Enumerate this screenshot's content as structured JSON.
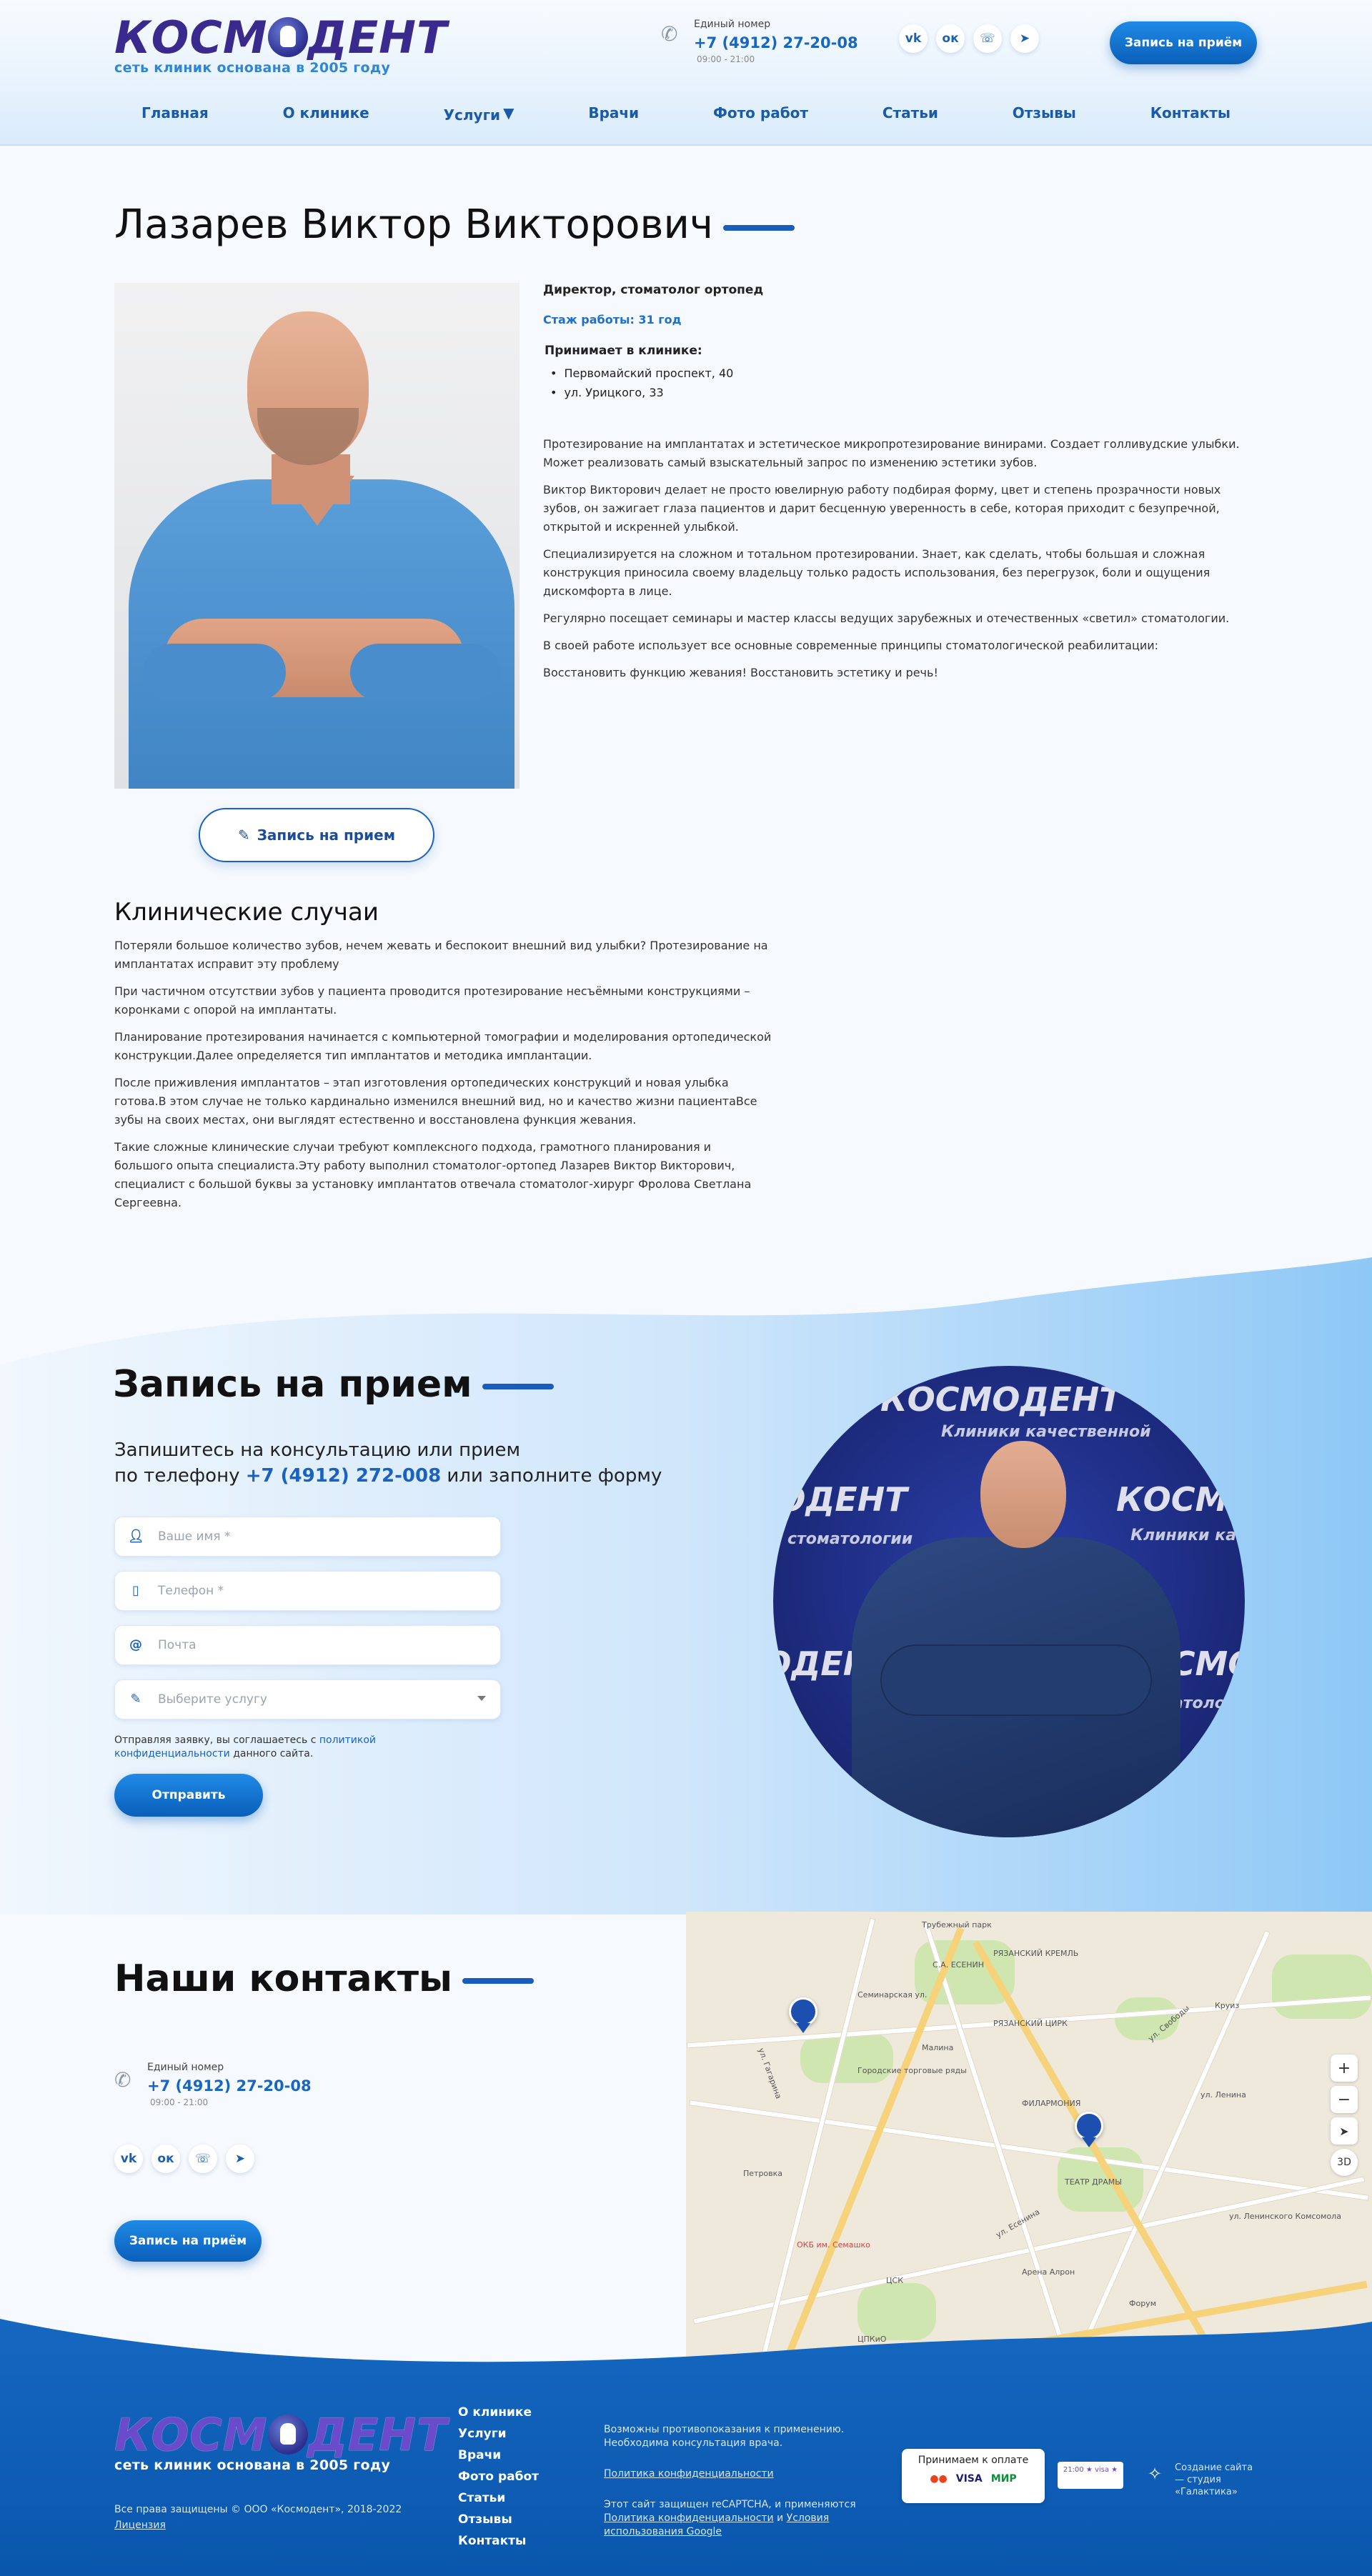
{
  "header": {
    "logo_text": "КОСМОДЕНТ",
    "logo_tagline": "сеть клиник основана в 2005 году",
    "phone_label": "Единый номер",
    "phone_number": "+7 (4912) 27-20-08",
    "phone_hours": "09:00 - 21:00",
    "socials": [
      "vk-icon",
      "ok-icon",
      "whatsapp-icon",
      "telegram-icon"
    ],
    "cta": "Запись на приём",
    "nav": [
      "Главная",
      "О клинике",
      "Услуги",
      "Врачи",
      "Фото работ",
      "Статьи",
      "Отзывы",
      "Контакты"
    ]
  },
  "doctor": {
    "name": "Лазарев Виктор Викторович",
    "role": "Директор, стоматолог ортопед",
    "experience": "Стаж работы: 31 год",
    "receives_label": "Принимает в клинике:",
    "addresses": [
      "Первомайский проспект, 40",
      "ул. Урицкого, 33"
    ],
    "paragraphs": [
      "Протезирование на имплантатах и эстетическое микропротезирование винирами. Создает голливудские улыбки. Может реализовать самый взыскательный запрос по изменению эстетики зубов.",
      "Виктор Викторович делает не просто ювелирную работу подбирая форму, цвет и степень прозрачности новых зубов, он зажигает глаза пациентов и дарит бесценную уверенность в себе, которая приходит с безупречной, открытой и искренней улыбкой.",
      "Специализируется на сложном и тотальном протезировании. Знает, как сделать, чтобы большая и сложная конструкция приносила своему владельцу только радость использования, без перегрузок, боли и ощущения дискомфорта в лице.",
      "Регулярно посещает семинары и мастер классы ведущих зарубежных и отечественных «светил» стоматологии.",
      "В своей работе использует все основные современные принципы стоматологической реабилитации:",
      "Восстановить функцию жевания! Восстановить эстетику и речь!"
    ],
    "book_button": "Запись на прием"
  },
  "cases": {
    "title": "Клинические случаи",
    "paragraphs": [
      "Потеряли большое количество зубов, нечем жевать и беспокоит внешний вид улыбки? Протезирование на имплантатах исправит эту проблему",
      "При частичном отсутствии зубов у пациента проводится протезирование несъёмными конструкциями – коронками с опорой на имплантаты.",
      "Планирование протезирования начинается с компьютерной томографии и моделирования ортопедической конструкции.Далее определяется тип имплантатов и методика имплантации.",
      "После приживления имплантатов – этап изготовления ортопедических конструкций и новая улыбка готова.В этом случае не только кардинально изменился внешний вид, но и качество жизни пациентаВсе зубы на своих местах, они выглядят естественно и восстановлена функция жевания.",
      "Такие сложные клинические случаи требуют комплексного подхода, грамотного планирования и большого опыта специалиста.Эту работу выполнил стоматолог-ортопед Лазарев Виктор Викторович, специалист с большой буквы за установку имплантатов отвечала стоматолог-хирург Фролова Светлана Сергеевна."
    ]
  },
  "appointment": {
    "title": "Запись на прием",
    "subtitle_before": "Запишитесь на консультацию или прием",
    "subtitle_line2_before": "по телефону ",
    "subtitle_phone": "+7 (4912) 272-008",
    "subtitle_after": " или заполните форму",
    "fields": {
      "name_placeholder": "Ваше имя *",
      "phone_placeholder": "Телефон *",
      "email_placeholder": "Почта",
      "service_placeholder": "Выберите услугу"
    },
    "consent_before": "Отправляя заявку, вы соглашаетесь с ",
    "consent_link": "политикой конфиденциальности",
    "consent_after": " данного сайта.",
    "submit": "Отправить",
    "photo_banner_text": [
      "КОСМОДЕНТ",
      "Клиники качественной",
      "стоматологии"
    ]
  },
  "contacts": {
    "title": "Наши контакты",
    "phone_label": "Единый номер",
    "phone_number": "+7 (4912) 27-20-08",
    "phone_hours": "09:00 - 21:00",
    "cta": "Запись на приём",
    "map": {
      "labels": [
        "Трубежный парк",
        "Семинарская ул.",
        "С.А. ЕСЕНИН",
        "РЯЗАНСКИЙ КРЕМЛЬ",
        "РЯЗАНСКИЙ ЦИРК",
        "Малина",
        "ФИЛАРМОНИЯ",
        "Городские торговые ряды",
        "ул. Свободы",
        "ул. Ленина",
        "ТЕАТР ДРАМЫ",
        "Петровка",
        "Круиз",
        "ул. Есенина",
        "ОКБ им. Семашко",
        "ЦСК",
        "Арена Алрон",
        "Форум",
        "ЦПКиО",
        "ул. Гагарина",
        "ул. Ленинского Комсомола"
      ],
      "controls": [
        "+",
        "−",
        "➤",
        "3D"
      ]
    }
  },
  "footer": {
    "logo_text": "КОСМОДЕНТ",
    "logo_tagline": "сеть клиник основана в 2005 году",
    "copyright": "Все права защищены © ООО «Космодент», 2018-2022",
    "license": "Лицензия",
    "nav": [
      "О клинике",
      "Услуги",
      "Врачи",
      "Фото работ",
      "Статьи",
      "Отзывы",
      "Контакты"
    ],
    "warning": "Возможны противопоказания к применению. Необходима консультация врача.",
    "privacy": "Политика конфиденциальности",
    "recaptcha_before": "Этот сайт защищен reCAPTCHA, и применяются ",
    "recaptcha_link1": "Политика конфиденциальности",
    "recaptcha_mid": " и ",
    "recaptcha_link2": "Условия использования Google",
    "pay_label": "Принимаем к оплате",
    "pay_logos": [
      "Mastercard",
      "VISA",
      "МИР"
    ],
    "badge": "21:00 ★ visa ★",
    "studio": "Создание сайта — студия «Галактика»"
  }
}
